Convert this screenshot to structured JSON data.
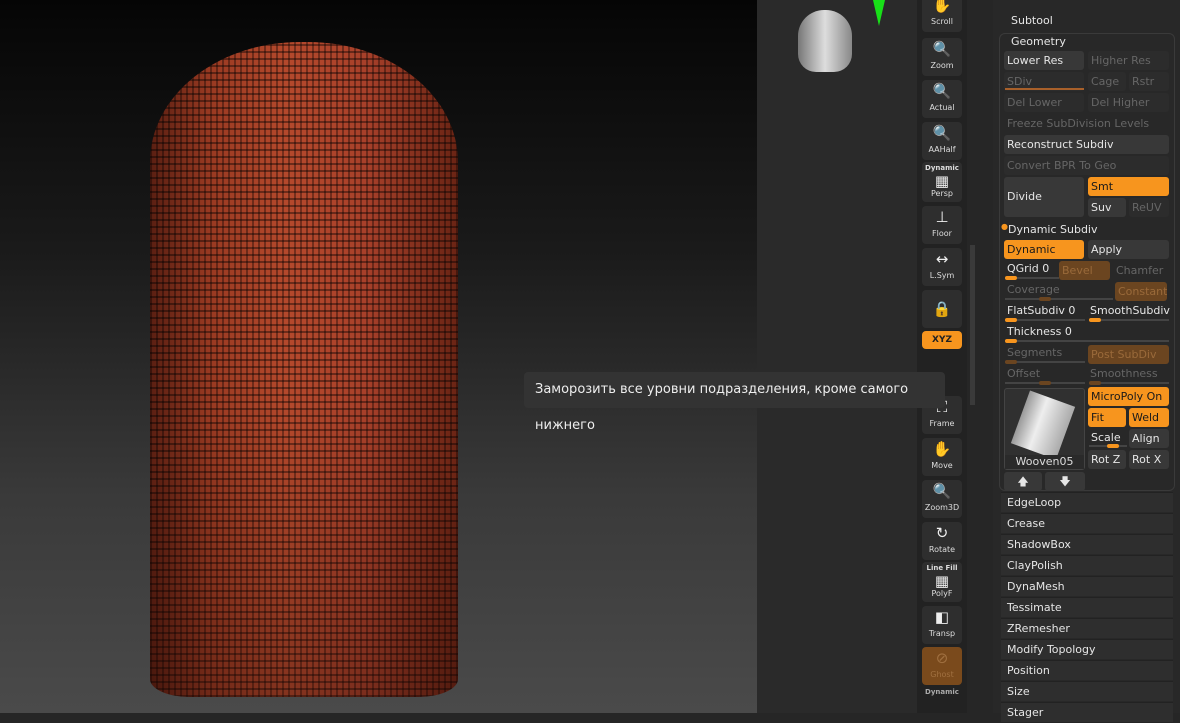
{
  "tooltip": "Заморозить все уровни подразделения, кроме самого нижнего",
  "toolbar": {
    "scroll": "Scroll",
    "zoom": "Zoom",
    "actual": "Actual",
    "aahalf": "AAHalf",
    "dynamic": "Dynamic",
    "persp": "Persp",
    "floor": "Floor",
    "lsym": "L.Sym",
    "xyz": "XYZ",
    "frame": "Frame",
    "move": "Move",
    "zoom3d": "Zoom3D",
    "rotate": "Rotate",
    "linefill": "Line Fill",
    "polyf": "PolyF",
    "transp": "Transp",
    "ghost": "Ghost",
    "dynamic2": "Dynamic"
  },
  "panel": {
    "subtool": "Subtool",
    "geometry": "Geometry",
    "lower_res": "Lower Res",
    "higher_res": "Higher Res",
    "sdiv": "SDiv",
    "cage": "Cage",
    "rstr": "Rstr",
    "del_lower": "Del Lower",
    "del_higher": "Del Higher",
    "freeze": "Freeze SubDivision Levels",
    "reconstruct": "Reconstruct Subdiv",
    "convert_bpr": "Convert BPR To Geo",
    "divide": "Divide",
    "smt": "Smt",
    "suv": "Suv",
    "reuv": "ReUV",
    "dynamic_subdiv": "Dynamic Subdiv",
    "dynamic": "Dynamic",
    "apply": "Apply",
    "qgrid": "QGrid 0",
    "bevel": "Bevel",
    "chamfer": "Chamfer",
    "coverage": "Coverage",
    "constant": "Constant",
    "flatsubdiv": "FlatSubdiv 0",
    "smoothsubdiv": "SmoothSubdiv",
    "thickness": "Thickness 0",
    "segments": "Segments",
    "post_subdiv": "Post SubDiv",
    "offset": "Offset",
    "smoothness": "Smoothness",
    "micropoly_on": "MicroPoly On",
    "fit": "Fit",
    "weld": "Weld",
    "scale": "Scale",
    "align": "Align",
    "rotz": "Rot Z",
    "rotx": "Rot X",
    "micropoly_name": "Wooven05",
    "sections": [
      "EdgeLoop",
      "Crease",
      "ShadowBox",
      "ClayPolish",
      "DynaMesh",
      "Tessimate",
      "ZRemesher",
      "Modify Topology",
      "Position",
      "Size",
      "Stager"
    ]
  },
  "colors": {
    "accent": "#f7951e"
  }
}
